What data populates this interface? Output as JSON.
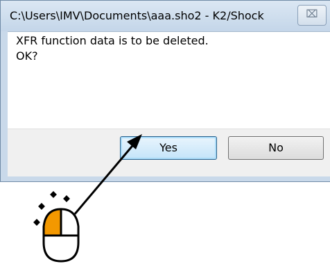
{
  "window": {
    "title": "C:\\Users\\IMV\\Documents\\aaa.sho2 - K2/Shock",
    "close_glyph": "⌧"
  },
  "message": {
    "line1": "XFR function data is to be deleted.",
    "line2": "OK?"
  },
  "buttons": {
    "yes_label": "Yes",
    "no_label": "No"
  },
  "annotation": {
    "arrow_icon": "pointer-arrow",
    "mouse_icon": "mouse-left-click-icon",
    "highlight_color": "#f39800"
  }
}
